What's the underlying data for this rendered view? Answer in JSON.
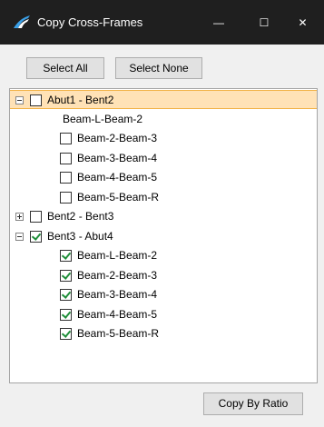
{
  "window": {
    "title": "Copy Cross-Frames",
    "minimize_glyph": "—",
    "maximize_glyph": "☐",
    "close_glyph": "✕"
  },
  "toolbar": {
    "select_all": "Select All",
    "select_none": "Select None"
  },
  "tree": [
    {
      "level": 0,
      "label": "Abut1 - Bent2",
      "expander": "minus",
      "checkbox": true,
      "checked": false,
      "selected": true
    },
    {
      "level": 1,
      "label": "Beam-L-Beam-2",
      "checkbox": false,
      "checked": false
    },
    {
      "level": 1,
      "label": "Beam-2-Beam-3",
      "checkbox": true,
      "checked": false
    },
    {
      "level": 1,
      "label": "Beam-3-Beam-4",
      "checkbox": true,
      "checked": false
    },
    {
      "level": 1,
      "label": "Beam-4-Beam-5",
      "checkbox": true,
      "checked": false
    },
    {
      "level": 1,
      "label": "Beam-5-Beam-R",
      "checkbox": true,
      "checked": false
    },
    {
      "level": 0,
      "label": "Bent2 - Bent3",
      "expander": "plus",
      "checkbox": true,
      "checked": false
    },
    {
      "level": 0,
      "label": "Bent3 - Abut4",
      "expander": "minus",
      "checkbox": true,
      "checked": true
    },
    {
      "level": 1,
      "label": "Beam-L-Beam-2",
      "checkbox": true,
      "checked": true
    },
    {
      "level": 1,
      "label": "Beam-2-Beam-3",
      "checkbox": true,
      "checked": true
    },
    {
      "level": 1,
      "label": "Beam-3-Beam-4",
      "checkbox": true,
      "checked": true
    },
    {
      "level": 1,
      "label": "Beam-4-Beam-5",
      "checkbox": true,
      "checked": true
    },
    {
      "level": 1,
      "label": "Beam-5-Beam-R",
      "checkbox": true,
      "checked": true
    }
  ],
  "footer": {
    "copy_by_ratio": "Copy By Ratio"
  },
  "colors": {
    "titlebar": "#1f1f1f",
    "selection_fill": "#ffe2b6",
    "selection_border": "#f2b347",
    "check_mark": "#1f8f3a"
  }
}
